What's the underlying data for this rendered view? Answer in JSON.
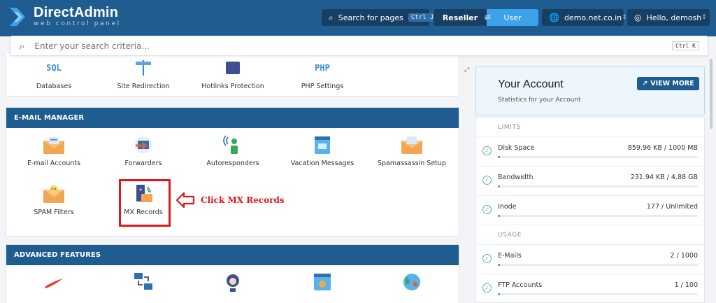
{
  "brand": {
    "title": "DirectAdmin",
    "subtitle": "web control panel"
  },
  "topbar": {
    "search_label": "Search for pages",
    "search_shortcut": "Ctrl J",
    "role_reseller": "Reseller",
    "role_user": "User",
    "domain": "demo.net.co.in",
    "greeting": "Hello, demosh"
  },
  "search": {
    "placeholder": "Enter your search criteria...",
    "shortcut": "Ctrl K"
  },
  "top_tiles": [
    {
      "label": "Databases",
      "icon_text": "SQL"
    },
    {
      "label": "Site Redirection"
    },
    {
      "label": "Hotlinks Protection"
    },
    {
      "label": "PHP Settings",
      "icon_text": "PHP"
    }
  ],
  "email_manager": {
    "title": "E-MAIL MANAGER",
    "tiles": [
      {
        "label": "E-mail Accounts"
      },
      {
        "label": "Forwarders"
      },
      {
        "label": "Autoresponders"
      },
      {
        "label": "Vacation Messages"
      },
      {
        "label": "Spamassassin Setup"
      },
      {
        "label": "SPAM Filters"
      },
      {
        "label": "MX Records"
      }
    ]
  },
  "annotation": {
    "text": "Click MX Records",
    "color": "#e01818"
  },
  "advanced": {
    "title": "ADVANCED FEATURES"
  },
  "account": {
    "title": "Your Account",
    "subtitle": "Statistics for your Account",
    "view_more": "VIEW MORE"
  },
  "limits": {
    "label": "LIMITS",
    "rows": [
      {
        "name": "Disk Space",
        "value": "859.96 KB / 1000 MB",
        "fraction": 0.01
      },
      {
        "name": "Bandwidth",
        "value": "231.94 KB / 4.88 GB",
        "fraction": 0.01
      },
      {
        "name": "Inode",
        "value": "177 / Unlimited",
        "fraction": 0.01
      }
    ]
  },
  "usage": {
    "label": "USAGE",
    "rows": [
      {
        "name": "E-Mails",
        "value": "2 / 1000",
        "fraction": 0.01
      },
      {
        "name": "FTP Accounts",
        "value": "1 / 100",
        "fraction": 0.01
      }
    ]
  },
  "colors": {
    "header": "#1f5d91",
    "accent": "#3da2ea",
    "annotation": "#e01818",
    "progress": "#4caf6e"
  }
}
